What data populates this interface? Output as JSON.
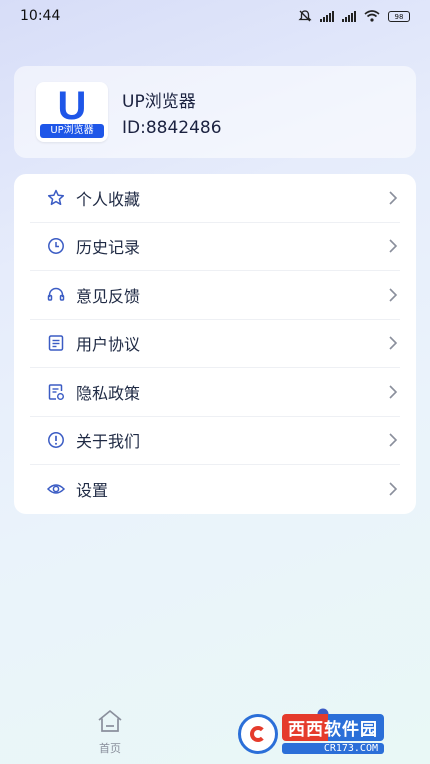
{
  "status_bar": {
    "time": "10:44",
    "battery": "98"
  },
  "profile": {
    "logo_letter": "U",
    "logo_band_text": "UP浏览器",
    "app_name": "UP浏览器",
    "user_id": "ID:8842486"
  },
  "menu": {
    "items": [
      {
        "label": "个人收藏",
        "icon": "star-icon"
      },
      {
        "label": "历史记录",
        "icon": "clock-icon"
      },
      {
        "label": "意见反馈",
        "icon": "headset-icon"
      },
      {
        "label": "用户协议",
        "icon": "document-icon"
      },
      {
        "label": "隐私政策",
        "icon": "privacy-document-icon"
      },
      {
        "label": "关于我们",
        "icon": "info-icon"
      },
      {
        "label": "设置",
        "icon": "eye-settings-icon"
      }
    ]
  },
  "tab_bar": {
    "home_label": "首页"
  },
  "watermark": {
    "main": "西西软件园",
    "sub": "CR173.COM"
  },
  "colors": {
    "accent": "#1e56e8",
    "icon_color": "#3b5cc4",
    "chevron": "#8a8f9c"
  }
}
